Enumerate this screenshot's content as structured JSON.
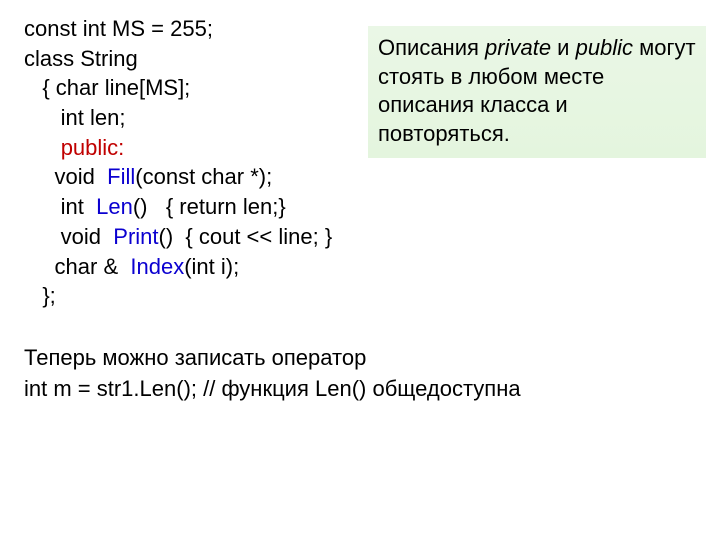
{
  "code": {
    "l1": "const int MS = 255;",
    "l2": "class String",
    "l3": "   { char line[MS];",
    "l4": "      int len;",
    "l5_indent": "      ",
    "l5_public": "public:",
    "l6a": "     void  ",
    "l6b": "Fill",
    "l6c": "(const char *);",
    "l7a": "      int  ",
    "l7b": "Len",
    "l7c": "()   { return len;}",
    "l8a": "      void  ",
    "l8b": "Print",
    "l8c": "()  { cout << line; }",
    "l9a": "     char &  ",
    "l9b": "Index",
    "l9c": "(int i);",
    "l10": "   };"
  },
  "note": {
    "t1": "Описания ",
    "t2": "private",
    "t3": " и ",
    "t4": "public",
    "t5": " могут стоять в любом месте описания класса и повторяться."
  },
  "para": {
    "p1": "Теперь можно записать оператор",
    "p2": "int m = str1.Len();    // функция Len() общедоступна"
  }
}
